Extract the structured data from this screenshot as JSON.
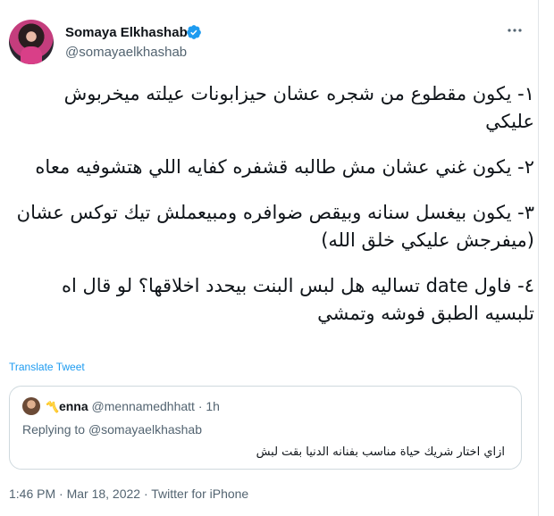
{
  "author": {
    "display_name": "Somaya Elkhashab",
    "handle": "@somayaelkhashab",
    "verified": true
  },
  "tweet": {
    "paragraphs": [
      "١- يكون مقطوع من شجره عشان حيزابونات عيلته ميخربوش عليكي",
      "٢- يكون غني عشان مش طالبه قشفره كفايه اللي هتشوفيه معاه",
      "٣- يكون بيغسل سنانه وبيقص ضوافره ومبيعملش تيك توكس عشان (ميفرجش عليكي خلق الله)",
      "٤- فاول date تساليه هل لبس البنت بيحدد اخلاقها؟ لو قال اه تلبسيه الطبق فوشه وتمشي"
    ],
    "translate_label": "Translate Tweet",
    "timestamp": "1:46 PM · Mar 18, 2022",
    "source": "Twitter for iPhone"
  },
  "quoted_tweet": {
    "name_prefix": "〽️",
    "name": "enna",
    "handle": "@mennamedhhatt",
    "time": "1h",
    "replying_label": "Replying to",
    "replying_handle": "@somayaelkhashab",
    "text": "ازاي اختار شريك حياة مناسب بفنانه الدنيا بقت لبش"
  },
  "colors": {
    "verified": "#1d9bf0",
    "link": "#1d9bf0",
    "muted": "#536471",
    "text": "#0f1419"
  },
  "icons": [
    "verified-badge-icon",
    "more-options-icon"
  ]
}
